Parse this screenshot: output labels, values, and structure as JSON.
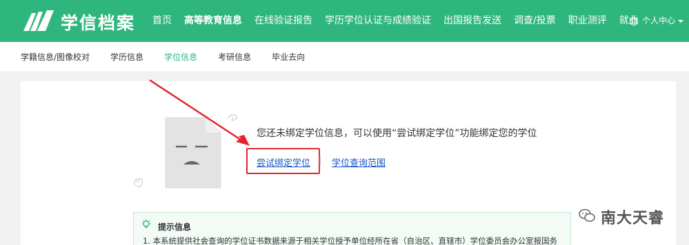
{
  "header": {
    "brand": "学信档案",
    "nav": [
      {
        "label": "首页"
      },
      {
        "label": "高等教育信息"
      },
      {
        "label": "在线验证报告"
      },
      {
        "label": "学历学位认证与成绩验证"
      },
      {
        "label": "出国报告发送"
      },
      {
        "label": "调查/投票"
      },
      {
        "label": "职业测评"
      },
      {
        "label": "就业"
      }
    ],
    "active_nav": "高等教育信息",
    "user_menu_label": "个人中心"
  },
  "subnav": {
    "items": [
      {
        "label": "学籍信息/图像校对"
      },
      {
        "label": "学历信息"
      },
      {
        "label": "学位信息"
      },
      {
        "label": "考研信息"
      },
      {
        "label": "毕业去向"
      }
    ],
    "active": "学位信息"
  },
  "empty_state": {
    "message": "您还未绑定学位信息，可以使用“尝试绑定学位”功能绑定您的学位",
    "primary_link": "尝试绑定学位",
    "separator": "|",
    "secondary_link": "学位查询范围"
  },
  "tips": {
    "title": "提示信息",
    "line1": "1. 本系统提供社会查询的学位证书数据来源于相关学位授予单位经所在省（自治区、直辖市）学位委员会办公室报国务"
  },
  "watermark": {
    "text": "南大天睿"
  },
  "colors": {
    "brand_green": "#2fb67e",
    "link_blue": "#1a56c8",
    "annotation_red": "#e0262a"
  },
  "icons": {
    "logo": "book-logo-icon",
    "user": "user-circle-icon",
    "tip": "lightbulb-icon",
    "empty": "sad-document-icon",
    "watermark": "wechat-icon"
  }
}
